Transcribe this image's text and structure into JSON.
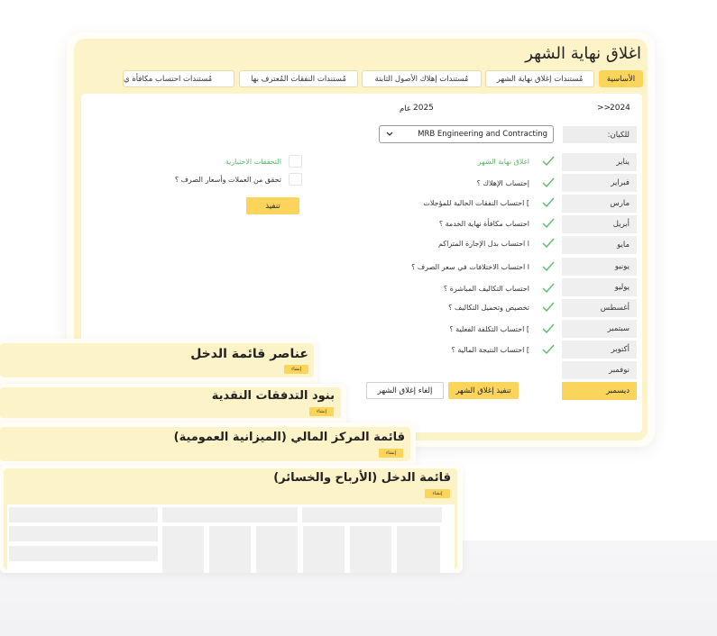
{
  "main": {
    "title": "اغلاق نهاية الشهر",
    "tabs": [
      {
        "label": "الأساسية",
        "active": true
      },
      {
        "label": "مُستندات إغلاق نهاية الشهر",
        "active": false
      },
      {
        "label": "مُستندات إهلاك الأصول الثابتة",
        "active": false
      },
      {
        "label": "مُستندات النفقات المُعترف بها",
        "active": false
      },
      {
        "label": "مُستندات احتساب مكافأة ي",
        "active": false
      }
    ],
    "year_selected": "2024",
    "year_prev_arrow": ">>",
    "year_other": "2025",
    "year_suffix": "عام",
    "entity_label": ":للكيان",
    "entity_value": "MRB Engineering and Contracting",
    "months": [
      "يناير",
      "فبراير",
      "مارس",
      "أبريل",
      "مايو",
      "يونيو",
      "يوليو",
      "أغسطس",
      "سبتمبر",
      "أكتوبر",
      "نوفمبر",
      "ديسمبر"
    ],
    "active_month": "ديسمبر",
    "steps": [
      {
        "label": "اغلاق نهاية الشهر",
        "checked": true,
        "highlight": true
      },
      {
        "label": "إحتساب الإهلاك ؟",
        "checked": true,
        "highlight": false
      },
      {
        "label": "] احتساب النفقات الحالية للمؤجلات",
        "checked": true,
        "highlight": false
      },
      {
        "label": "احتساب مكافأة نهاية الخدمة ؟",
        "checked": true,
        "highlight": false
      },
      {
        "label": "ا احتساب بدل الإجازة المتراكم",
        "checked": true,
        "highlight": false
      },
      {
        "label": "ا احتساب الاختلافات في سعر الصرف ؟",
        "checked": true,
        "highlight": false
      },
      {
        "label": "احتساب التكاليف المباشرة ؟",
        "checked": true,
        "highlight": false
      },
      {
        "label": "تخصيص وتحميل التكاليف ؟",
        "checked": true,
        "highlight": false
      },
      {
        "label": "] احتساب التكلفة الفعلية ؟",
        "checked": true,
        "highlight": false
      },
      {
        "label": "] احتساب النتيجة المالية ؟",
        "checked": true,
        "highlight": false
      }
    ],
    "optional": {
      "heading": "التحققات الاختيارية",
      "item": "تحقق من العملات وأسعار الصرف ؟"
    },
    "execute_label": "تنفيذ",
    "execute_close_label": "تنفيذ إغلاق الشهر",
    "cancel_close_label": "إلغاء إغلاق الشهر",
    "accent_color": "#fbd55b",
    "check_color": "#5cb96b"
  },
  "cards": [
    {
      "title": "عناصر قائمة الدخل",
      "button": "إنشاء"
    },
    {
      "title": "بنود التدفقات النقدية",
      "button": "إنشاء"
    },
    {
      "title": "قائمة المركز المالي (الميزانية العمومية)",
      "button": "إنشاء"
    },
    {
      "title": "قائمة الدخل (الأرباح والخسائر)",
      "button": "إنشاء"
    }
  ]
}
